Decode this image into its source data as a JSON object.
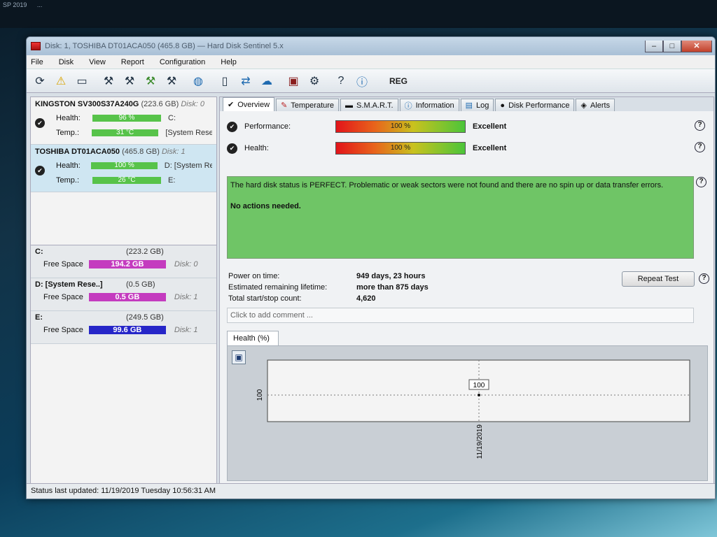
{
  "desktop": {
    "top_items": [
      "SP 2019",
      "..."
    ]
  },
  "window": {
    "title": "Disk: 1, TOSHIBA DT01ACA050 (465.8 GB) — Hard Disk Sentinel 5.x"
  },
  "menu": [
    "File",
    "Disk",
    "View",
    "Report",
    "Configuration",
    "Help"
  ],
  "toolbar": {
    "reg_label": "REG"
  },
  "disks": [
    {
      "name": "KINGSTON SV300S37A240G",
      "size": "(223.6 GB)",
      "disk": "Disk: 0",
      "health_label": "Health:",
      "health": "96 %",
      "health_extra": "C:",
      "temp_label": "Temp.:",
      "temp": "31 °C",
      "temp_extra": "[System Rese"
    },
    {
      "name": "TOSHIBA DT01ACA050",
      "size": "(465.8 GB)",
      "disk": "Disk: 1",
      "health_label": "Health:",
      "health": "100 %",
      "health_extra": "D: [System Re",
      "temp_label": "Temp.:",
      "temp": "26 °C",
      "temp_extra": "E:"
    }
  ],
  "volumes": [
    {
      "name": "C:",
      "size": "(223.2 GB)",
      "free_label": "Free Space",
      "free": "194.2 GB",
      "disk": "Disk: 0",
      "color": "#c43bbf"
    },
    {
      "name": "D: [System Rese..]",
      "size": "(0.5 GB)",
      "free_label": "Free Space",
      "free": "0.5 GB",
      "disk": "Disk: 1",
      "color": "#c43bbf"
    },
    {
      "name": "E:",
      "size": "(249.5 GB)",
      "free_label": "Free Space",
      "free": "99.6 GB",
      "disk": "Disk: 1",
      "color": "#2626c8"
    }
  ],
  "tabs": [
    "Overview",
    "Temperature",
    "S.M.A.R.T.",
    "Information",
    "Log",
    "Disk Performance",
    "Alerts"
  ],
  "overview": {
    "performance_label": "Performance:",
    "performance_value": "100 %",
    "performance_rating": "Excellent",
    "health_label": "Health:",
    "health_value": "100 %",
    "health_rating": "Excellent",
    "status_text": "The hard disk status is PERFECT. Problematic or weak sectors were not found and there are no spin up or data transfer errors.",
    "status_action": "No actions needed.",
    "power_on_label": "Power on time:",
    "power_on_value": "949 days, 23 hours",
    "lifetime_label": "Estimated remaining lifetime:",
    "lifetime_value": "more than 875 days",
    "startstop_label": "Total start/stop count:",
    "startstop_value": "4,620",
    "repeat_label": "Repeat Test",
    "comment_placeholder": "Click to add comment ...",
    "graph_tab": "Health (%)"
  },
  "chart_data": {
    "type": "line",
    "series": [
      {
        "x": [
          "11/19/2019"
        ],
        "values": [
          100
        ]
      }
    ],
    "y_tick": "100",
    "x_tick": "11/19/2019",
    "point_label": "100"
  },
  "status_bar": "Status last updated: 11/19/2019 Tuesday 10:56:31 AM"
}
